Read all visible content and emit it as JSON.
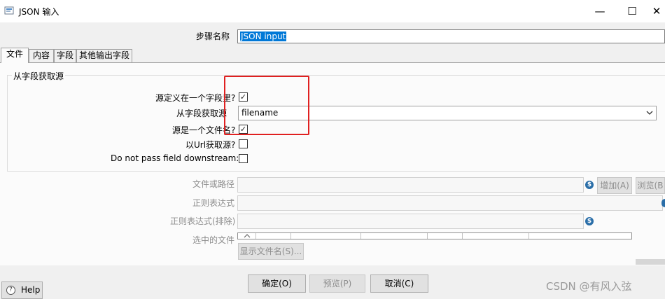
{
  "window": {
    "title": "JSON 输入",
    "minimize_symbol": "—",
    "maximize_symbol": "☐",
    "close_symbol": "✕",
    "icon": "json-input-step-icon"
  },
  "step": {
    "label": "步骤名称",
    "value": "JSON input"
  },
  "tabs": [
    {
      "label": "文件",
      "active": true
    },
    {
      "label": "内容",
      "active": false
    },
    {
      "label": "字段",
      "active": false
    },
    {
      "label": "其他输出字段",
      "active": false
    }
  ],
  "source_group": {
    "title": "从字段获取源",
    "source_in_field_label": "源定义在一个字段里?",
    "source_in_field_checked": true,
    "field_label": "从字段获取源",
    "field_value": "filename",
    "source_is_filename_label": "源是一个文件名?",
    "source_is_filename_checked": true,
    "read_url_label": "以Url获取源?",
    "read_url_checked": false,
    "do_not_pass_label": "Do not pass field downstream:",
    "do_not_pass_checked": false
  },
  "file_section": {
    "file_or_dir_label": "文件或路径",
    "regex_label": "正则表达式",
    "regex_exclude_label": "正则表达式(排除)",
    "selected_files_label": "选中的文件",
    "add_button": "增加(A)",
    "browse_button": "浏览(B",
    "show_filenames_button": "显示文件名(S)...",
    "variable_icon_glyph": "$"
  },
  "buttons": {
    "ok": "确定(O)",
    "preview": "预览(P)",
    "cancel": "取消(C)",
    "help": "Help",
    "help_glyph": "?"
  },
  "check_glyph": "✓",
  "watermark": "CSDN @有风入弦",
  "colors": {
    "annotation_box": "#e02020",
    "selection": "#0078d7",
    "variable_icon": "#2a6ea8"
  }
}
